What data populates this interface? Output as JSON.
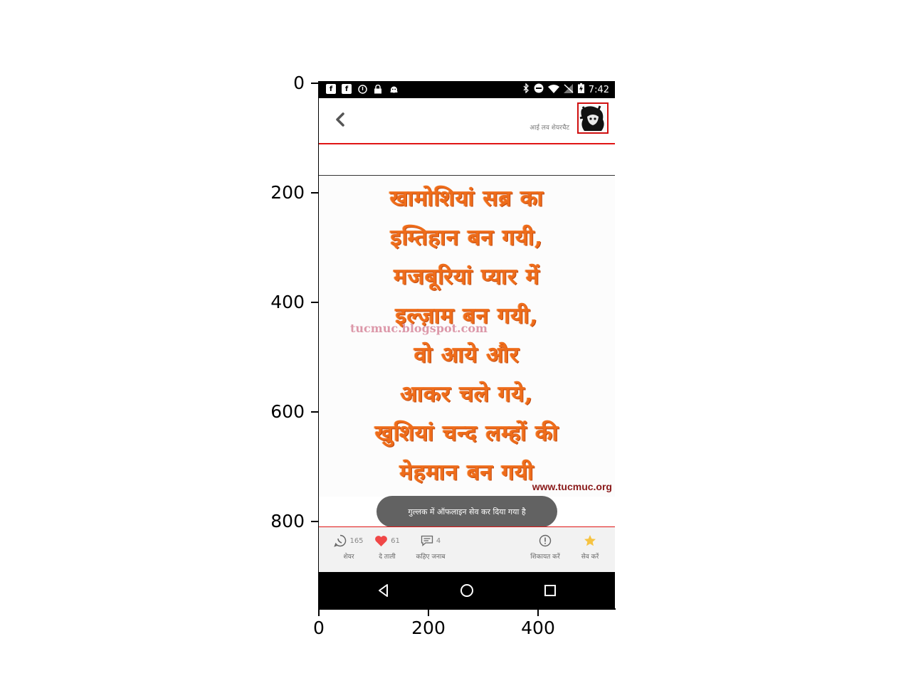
{
  "axes": {
    "y_ticks": [
      "0",
      "200",
      "400",
      "600",
      "800"
    ],
    "x_ticks": [
      "0",
      "200",
      "400"
    ]
  },
  "status_bar": {
    "time": "7:42",
    "left_icons": [
      "facebook-icon",
      "facebook-icon",
      "circle-info-icon",
      "lock-icon",
      "android-icon"
    ],
    "right_icons": [
      "bluetooth-icon",
      "do-not-disturb-icon",
      "wifi-icon",
      "no-signal-icon",
      "battery-charging-icon"
    ]
  },
  "header": {
    "back_icon": "chevron-left-icon",
    "caption": "आई लव शेयरचैट",
    "avatar_icon": "profile-avatar"
  },
  "content": {
    "poem_lines": [
      "खामोशियां सब्र का",
      "इम्तिहान बन गयी,",
      "मजबूरियां प्यार में",
      "इल्ज़ाम बन गयी,",
      "वो आये और",
      "आकर चले गये,",
      "खुशियां चन्द लम्हों की",
      "मेहमान बन गयी"
    ],
    "watermark": "tucmuc.blogspot.com",
    "site": "www.tucmuc.org"
  },
  "toast": {
    "text": "गुल्लक में ऑफलाइन सेव कर दिया गया है"
  },
  "actions": {
    "share": {
      "count": "165",
      "label": "शेयर"
    },
    "like": {
      "count": "61",
      "label": "दे ताली"
    },
    "comment": {
      "count": "4",
      "label": "कहिए जनाब"
    },
    "report": {
      "label": "शिकायत करें"
    },
    "save": {
      "label": "सेव करें"
    }
  },
  "colors": {
    "accent_red": "#e01414",
    "poem_orange": "#ee6c1a",
    "heart_red": "#f04747",
    "star_yellow": "#f6c342"
  }
}
